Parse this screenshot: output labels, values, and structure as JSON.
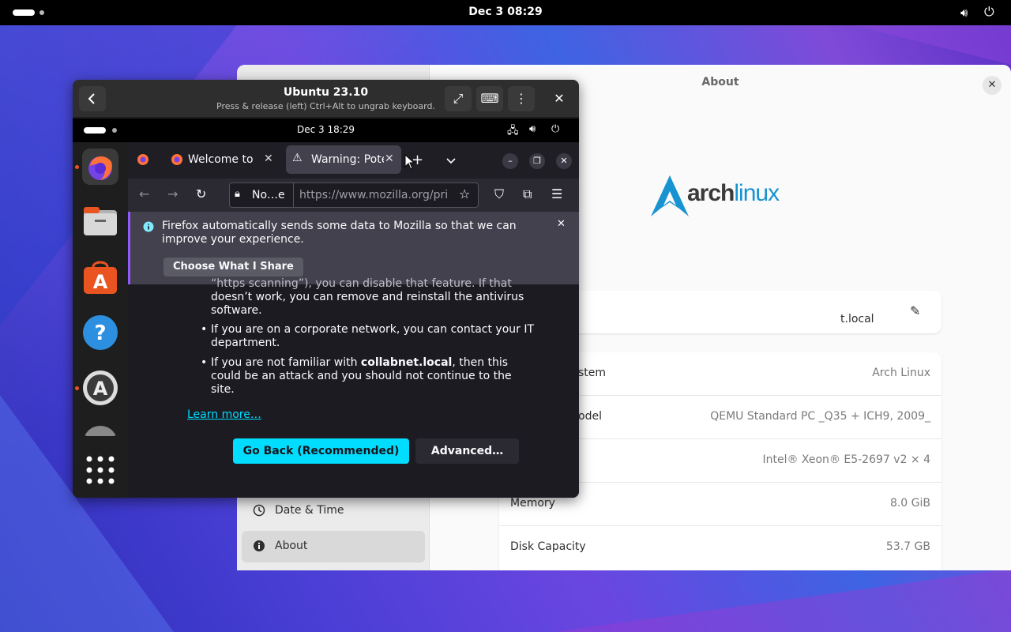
{
  "desktop": {
    "clock": "Dec 3  08:29"
  },
  "settings": {
    "title": "About",
    "sidebar": [
      {
        "label": "Date & Time",
        "icon": "clock-icon"
      },
      {
        "label": "About",
        "icon": "info-icon"
      }
    ],
    "logo": {
      "part1": "arch",
      "part2": "linux"
    },
    "device_name_value": "t.local",
    "rows": [
      {
        "key": "stem",
        "value": "Arch Linux"
      },
      {
        "key": "odel",
        "value": "QEMU Standard PC _Q35 + ICH9, 2009_"
      },
      {
        "key": "",
        "value": "Intel® Xeon® E5-2697 v2 × 4"
      },
      {
        "key": "Memory",
        "value": "8.0 GiB"
      },
      {
        "key": "Disk Capacity",
        "value": "53.7 GB"
      }
    ]
  },
  "vm": {
    "title": "Ubuntu 23.10",
    "subtitle": "Press & release (left) Ctrl+Alt to ungrab keyboard.",
    "guest_clock": "Dec 3  18:29",
    "firefox": {
      "tabs": [
        {
          "label": "Welcome to Fi"
        },
        {
          "label": "Warning: Pote"
        }
      ],
      "url_identity": "No…e",
      "url": "https://www.mozilla.org/pri",
      "notification": "Firefox automatically sends some data to Mozilla so that we can improve your experience.",
      "notification_button": "Choose What I Share",
      "content": {
        "line0": "“https scanning”), you can disable that feature. If that",
        "line1": "doesn’t work, you can remove and reinstall the antivirus",
        "line2": "software.",
        "bullet1a": "If you are on a corporate network, you can contact your IT",
        "bullet1b": "department.",
        "bullet2a_pre": "If you are not familiar with ",
        "bullet2a_bold": "collabnet.local",
        "bullet2a_post": ", then this",
        "bullet2b": "could be an attack and you should not continue to the",
        "bullet2c": "site.",
        "learn_more": "Learn more…",
        "go_back": "Go Back (Recommended)",
        "advanced": "Advanced…"
      }
    }
  },
  "colors": {
    "accent_cyan": "#00ddff",
    "link": "#00ddff",
    "arch_blue": "#1793d1",
    "ubuntu_orange": "#e95420"
  }
}
